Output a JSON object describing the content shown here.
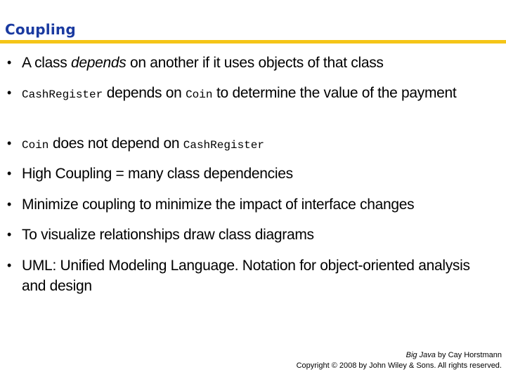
{
  "slide": {
    "title": "Coupling",
    "accent_colors": {
      "title": "#1a3aa0",
      "rule": "#f5c518"
    },
    "bullets": [
      {
        "parts": [
          {
            "text": "A class ",
            "style": "normal"
          },
          {
            "text": "depends",
            "style": "italic"
          },
          {
            "text": " on another if it uses objects of that class",
            "style": "normal"
          }
        ]
      },
      {
        "parts": [
          {
            "text": "CashRegister",
            "style": "code"
          },
          {
            "text": " depends on ",
            "style": "normal"
          },
          {
            "text": "Coin",
            "style": "code"
          },
          {
            "text": " to determine the value of the payment",
            "style": "normal"
          }
        ]
      },
      {
        "parts": [
          {
            "text": "Coin",
            "style": "code"
          },
          {
            "text": " does not depend on ",
            "style": "normal"
          },
          {
            "text": "CashRegister",
            "style": "code"
          }
        ]
      },
      {
        "parts": [
          {
            "text": "High Coupling = many class dependencies",
            "style": "normal"
          }
        ]
      },
      {
        "parts": [
          {
            "text": "Minimize coupling to minimize the impact of interface changes",
            "style": "normal"
          }
        ]
      },
      {
        "parts": [
          {
            "text": "To visualize relationships draw class diagrams",
            "style": "normal"
          }
        ]
      },
      {
        "parts": [
          {
            "text": "UML: Unified Modeling Language. Notation for object-oriented analysis and design",
            "style": "normal"
          }
        ]
      }
    ],
    "bullet_glyph": "•",
    "footer": {
      "book_title": "Big Java",
      "author_line": " by Cay Horstmann",
      "copyright": "Copyright © 2008 by John Wiley & Sons.  All rights reserved."
    }
  }
}
